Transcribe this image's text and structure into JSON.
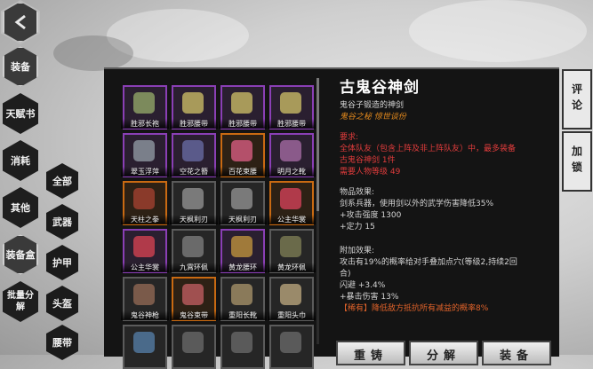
{
  "nav": {
    "main_tabs": [
      "装备",
      "天赋书",
      "消耗",
      "其他",
      "装备盒",
      "批量分解"
    ],
    "sub_tabs": [
      "全部",
      "武器",
      "护甲",
      "头盔",
      "腰带"
    ]
  },
  "items": [
    {
      "name": "胜邪长袍",
      "rarity": "purple",
      "color": "#7c8a5c"
    },
    {
      "name": "胜邪腰带",
      "rarity": "purple",
      "color": "#a89a5a"
    },
    {
      "name": "胜邪腰带",
      "rarity": "purple",
      "color": "#a89a5a"
    },
    {
      "name": "胜邪腰带",
      "rarity": "purple",
      "color": "#a89a5a"
    },
    {
      "name": "翠玉浮萍",
      "rarity": "purple",
      "color": "#7a7f8a"
    },
    {
      "name": "空花之簪",
      "rarity": "purple",
      "color": "#5a5a8a"
    },
    {
      "name": "百花束腰",
      "rarity": "orange",
      "color": "#b4506a"
    },
    {
      "name": "明月之靴",
      "rarity": "purple",
      "color": "#8a5a8a"
    },
    {
      "name": "天柱之拳",
      "rarity": "orange",
      "color": "#8a3a2a"
    },
    {
      "name": "天枫利刃",
      "rarity": "gray",
      "color": "#7a7a7a"
    },
    {
      "name": "天枫利刃",
      "rarity": "gray",
      "color": "#7a7a7a"
    },
    {
      "name": "公主华裳",
      "rarity": "orange",
      "color": "#b03a4a"
    },
    {
      "name": "公主华裳",
      "rarity": "purple",
      "color": "#b03a4a"
    },
    {
      "name": "九霄环佩",
      "rarity": "gray",
      "color": "#6a6a6a"
    },
    {
      "name": "黄龙腰环",
      "rarity": "purple",
      "color": "#a07a3a"
    },
    {
      "name": "黄龙环佩",
      "rarity": "gray",
      "color": "#6a6a4a"
    },
    {
      "name": "鬼谷神枪",
      "rarity": "gray",
      "color": "#7a5a4a"
    },
    {
      "name": "鬼谷束带",
      "rarity": "orange",
      "color": "#a05050"
    },
    {
      "name": "重阳长靴",
      "rarity": "gray",
      "color": "#8a7a5a"
    },
    {
      "name": "重阳头巾",
      "rarity": "gray",
      "color": "#9a8a6a"
    },
    {
      "name": "",
      "rarity": "gray",
      "color": "#4a6a8a"
    },
    {
      "name": "",
      "rarity": "gray",
      "color": "#5a5a5a"
    },
    {
      "name": "",
      "rarity": "gray",
      "color": "#5a5a5a"
    },
    {
      "name": "",
      "rarity": "gray",
      "color": "#5a5a5a"
    }
  ],
  "detail": {
    "title": "古鬼谷神剑",
    "subtitle": "鬼谷子锻造的神剑",
    "tags": "鬼谷之秘  惊世谈份",
    "req_header": "要求:",
    "req_lines": [
      "全体队友（包含上阵及非上阵队友）中，最多装备",
      "古鬼谷神剑 1件",
      "需要人物等级 49"
    ],
    "effect_header": "物品效果:",
    "effect_lines": [
      "剑系兵器，使用剑以外的武学伤害降低35%",
      "+攻击强度 1300",
      "+定力 15"
    ],
    "bonus_header": "附加效果:",
    "bonus_lines": [
      "攻击有19%的概率给对手叠加点穴(等级2,持续2回",
      "合)",
      "闪避 +3.4%",
      "+暴击伤害 13%"
    ],
    "rare_line": "【稀有】降低敌方抵抗所有减益的概率8%"
  },
  "buttons": {
    "forge": "重铸",
    "decompose": "分解",
    "equip": "装备"
  },
  "side": {
    "review": "评论",
    "lock": "加锁"
  }
}
